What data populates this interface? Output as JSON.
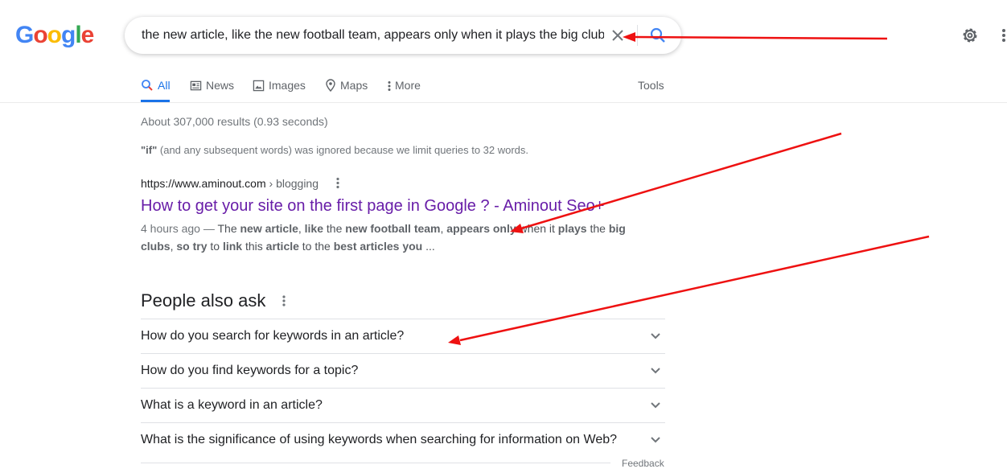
{
  "logo": {
    "letters": [
      "G",
      "o",
      "o",
      "g",
      "l",
      "e"
    ],
    "colors": [
      "#4285f4",
      "#ea4335",
      "#fbbc05",
      "#4285f4",
      "#34a853",
      "#ea4335"
    ]
  },
  "search": {
    "query": "the new article, like the new football team, appears only when it plays the big club"
  },
  "icons": {
    "clear": "close-icon",
    "search": "search-icon",
    "settings": "gear-icon",
    "apps": "apps-grid-icon"
  },
  "tabs": [
    {
      "label": "All",
      "icon": "search-icon"
    },
    {
      "label": "News",
      "icon": "news-icon"
    },
    {
      "label": "Images",
      "icon": "image-icon"
    },
    {
      "label": "Maps",
      "icon": "map-pin-icon"
    },
    {
      "label": "More",
      "icon": "more-vert-icon"
    }
  ],
  "tools_label": "Tools",
  "stats": "About 307,000 results (0.93 seconds)",
  "notice": {
    "term": "\"if\"",
    "text": " (and any subsequent words) was ignored because we limit queries to 32 words."
  },
  "result": {
    "url": "https://www.aminout.com",
    "crumb": " › blogging",
    "title": "How to get your site on the first page in Google ? - Aminout Seo+",
    "date": "4 hours ago — ",
    "snippet_parts": [
      {
        "t": "The ",
        "b": false
      },
      {
        "t": "new article",
        "b": true
      },
      {
        "t": ", ",
        "b": false
      },
      {
        "t": "like",
        "b": true
      },
      {
        "t": " the ",
        "b": false
      },
      {
        "t": "new football team",
        "b": true
      },
      {
        "t": ", ",
        "b": false
      },
      {
        "t": "appears only",
        "b": true
      },
      {
        "t": " when it ",
        "b": false
      },
      {
        "t": "plays",
        "b": true
      },
      {
        "t": " the ",
        "b": false
      },
      {
        "t": "big clubs",
        "b": true
      },
      {
        "t": ", ",
        "b": false
      },
      {
        "t": "so try",
        "b": true
      },
      {
        "t": " to ",
        "b": false
      },
      {
        "t": "link",
        "b": true
      },
      {
        "t": " this ",
        "b": false
      },
      {
        "t": "article",
        "b": true
      },
      {
        "t": " to the ",
        "b": false
      },
      {
        "t": "best articles you",
        "b": true
      },
      {
        "t": " ...",
        "b": false
      }
    ]
  },
  "paa": {
    "title": "People also ask",
    "questions": [
      "How do you search for keywords in an article?",
      "How do you find keywords for a topic?",
      "What is a keyword in an article?",
      "What is the significance of using keywords when searching for information on Web?"
    ]
  },
  "feedback_label": "Feedback",
  "colors": {
    "accent": "#1a73e8",
    "visited_link": "#681da8",
    "annotation_arrow": "#ee1111"
  }
}
